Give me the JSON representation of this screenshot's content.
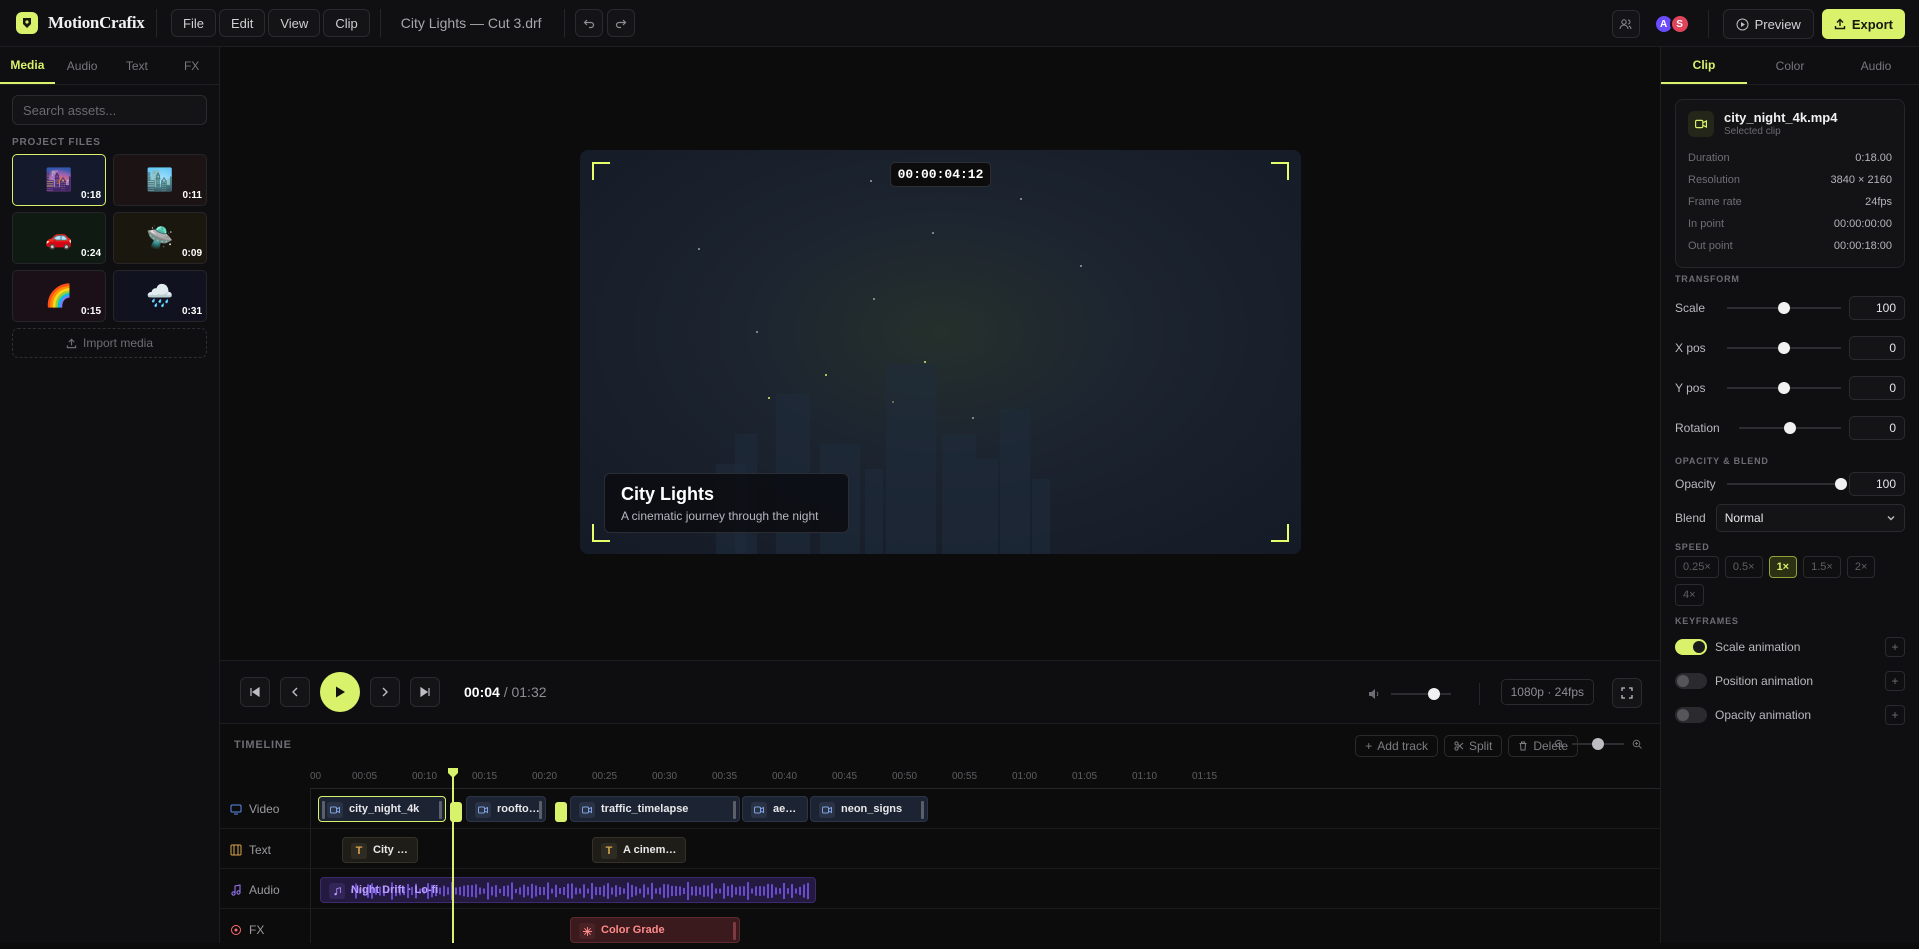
{
  "app": {
    "name": "MotionCrafix",
    "doc_title": "City Lights — Cut 3.drf"
  },
  "menu": [
    "File",
    "Edit",
    "View",
    "Clip"
  ],
  "header": {
    "preview_label": "Preview",
    "export_label": "Export",
    "avatars": [
      {
        "initial": "A",
        "color": "#6b4bff"
      },
      {
        "initial": "S",
        "color": "#e0445a"
      }
    ]
  },
  "left_panel": {
    "tabs": [
      "Media",
      "Audio",
      "Text",
      "FX"
    ],
    "search_placeholder": "Search assets...",
    "section_label": "PROJECT FILES",
    "files": [
      {
        "emoji": "🌆",
        "duration": "0:18",
        "bg": "#141a2c"
      },
      {
        "emoji": "🏙️",
        "duration": "0:11",
        "bg": "#1b1314"
      },
      {
        "emoji": "🚗",
        "duration": "0:24",
        "bg": "#0f1a13"
      },
      {
        "emoji": "🛸",
        "duration": "0:09",
        "bg": "#1a170e"
      },
      {
        "emoji": "🌈",
        "duration": "0:15",
        "bg": "#1c1018"
      },
      {
        "emoji": "🌧️",
        "duration": "0:31",
        "bg": "#10121f"
      }
    ],
    "import_label": "Import media"
  },
  "viewer": {
    "timecode": "00:00:04:12",
    "caption_title": "City Lights",
    "caption_subtitle": "A cinematic journey through the night"
  },
  "transport": {
    "current": "00:04",
    "total": "01:32",
    "resolution": "1080p · 24fps",
    "volume_level": 0.72
  },
  "timeline": {
    "title": "TIMELINE",
    "actions": [
      "Add track",
      "Split",
      "Delete"
    ],
    "ticks": [
      "00",
      "00:05",
      "00:10",
      "00:15",
      "00:20",
      "00:25",
      "00:30",
      "00:35",
      "00:40",
      "00:45",
      "00:50",
      "00:55",
      "01:00",
      "01:05",
      "01:10",
      "01:15"
    ],
    "tracks": [
      {
        "name": "Video",
        "color": "#5b8def"
      },
      {
        "name": "Text",
        "color": "#d9a44a"
      },
      {
        "name": "Audio",
        "color": "#a07bff"
      },
      {
        "name": "FX",
        "color": "#ff6b6b"
      }
    ],
    "video_clips": [
      "city_night_4k",
      "roofto…",
      "traffic_timelapse",
      "ae…",
      "neon_signs"
    ],
    "text_clips": [
      "City …",
      "A cinem…"
    ],
    "audio_clip": "Night Drift · Lo-fi",
    "fx_clip": "Color Grade"
  },
  "right_panel": {
    "tabs": [
      "Clip",
      "Color",
      "Audio"
    ],
    "clip": {
      "name": "city_night_4k.mp4",
      "sub": "Selected clip"
    },
    "props": [
      {
        "k": "Duration",
        "v": "0:18.00"
      },
      {
        "k": "Resolution",
        "v": "3840 × 2160"
      },
      {
        "k": "Frame rate",
        "v": "24fps"
      },
      {
        "k": "In point",
        "v": "00:00:00:00"
      },
      {
        "k": "Out point",
        "v": "00:00:18:00"
      }
    ],
    "transform_label": "TRANSFORM",
    "transform": [
      {
        "label": "Scale",
        "value": "100",
        "level": 0.5
      },
      {
        "label": "X pos",
        "value": "0",
        "level": 0.5
      },
      {
        "label": "Y pos",
        "value": "0",
        "level": 0.5
      },
      {
        "label": "Rotation",
        "value": "0",
        "level": 0.5
      }
    ],
    "opacity_label": "OPACITY & BLEND",
    "opacity": {
      "label": "Opacity",
      "value": "100",
      "level": 1.0
    },
    "blend": {
      "label": "Blend",
      "value": "Normal"
    },
    "speed_label": "SPEED",
    "speeds": [
      "0.25×",
      "0.5×",
      "1×",
      "1.5×",
      "2×",
      "4×"
    ],
    "speed_active": "1×",
    "keyframes_label": "KEYFRAMES",
    "keyframes": [
      {
        "label": "Scale animation",
        "on": true
      },
      {
        "label": "Position animation",
        "on": false
      },
      {
        "label": "Opacity animation",
        "on": false
      }
    ]
  }
}
